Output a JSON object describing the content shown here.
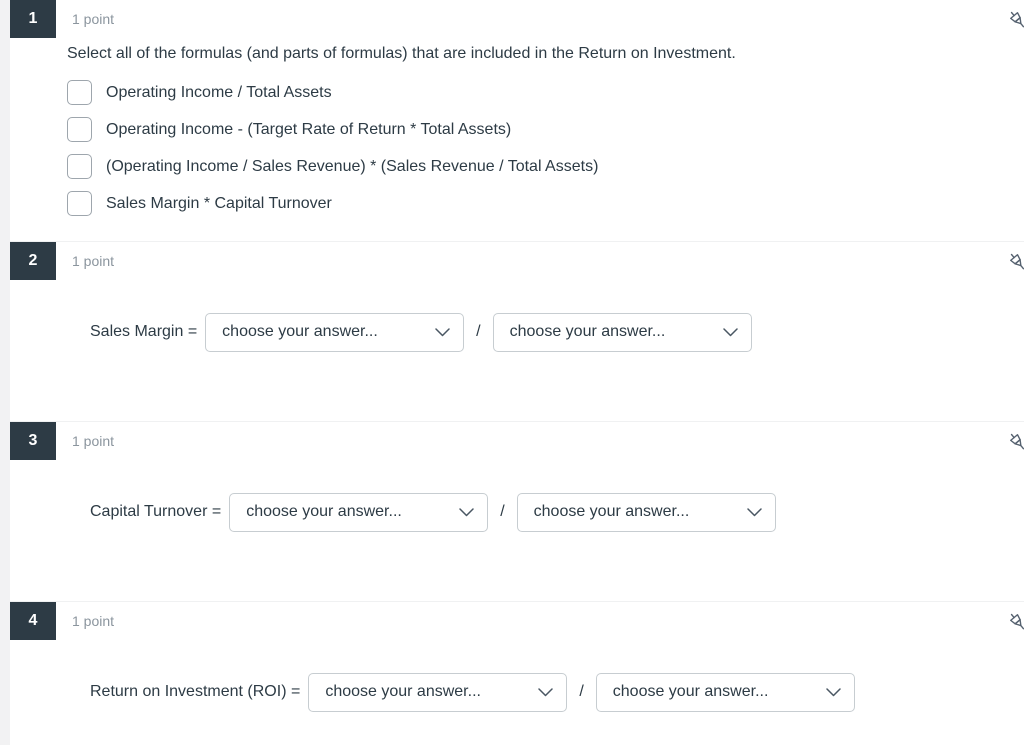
{
  "quiz": {
    "common": {
      "points_label": "1 point",
      "pin_icon": "pushpin-icon",
      "dropdown_placeholder": "choose your answer...",
      "divider_slash": "/",
      "accent_badge_color": "#2d3b45",
      "text_color": "#2d3b45",
      "muted_text_color": "#8b959e",
      "border_color": "#c7cdd1"
    },
    "questions": [
      {
        "number": "1",
        "points": "1 point",
        "type": "multiple-answer",
        "prompt": "Select all of the formulas (and parts of formulas) that are included in the Return on Investment.",
        "choices": [
          {
            "label": "Operating Income / Total Assets",
            "checked": false
          },
          {
            "label": "Operating Income - (Target Rate of Return * Total Assets)",
            "checked": false
          },
          {
            "label": "(Operating Income / Sales Revenue) * (Sales Revenue / Total Assets)",
            "checked": false
          },
          {
            "label": "Sales Margin * Capital Turnover",
            "checked": false
          }
        ]
      },
      {
        "number": "2",
        "points": "1 point",
        "type": "formula-dropdowns",
        "label": "Sales Margin =",
        "numerator": "choose your answer...",
        "denominator": "choose your answer...",
        "separator": "/"
      },
      {
        "number": "3",
        "points": "1 point",
        "type": "formula-dropdowns",
        "label": "Capital Turnover =",
        "numerator": "choose your answer...",
        "denominator": "choose your answer...",
        "separator": "/"
      },
      {
        "number": "4",
        "points": "1 point",
        "type": "formula-dropdowns",
        "label": "Return on Investment (ROI) =",
        "numerator": "choose your answer...",
        "denominator": "choose your answer...",
        "separator": "/"
      }
    ]
  }
}
